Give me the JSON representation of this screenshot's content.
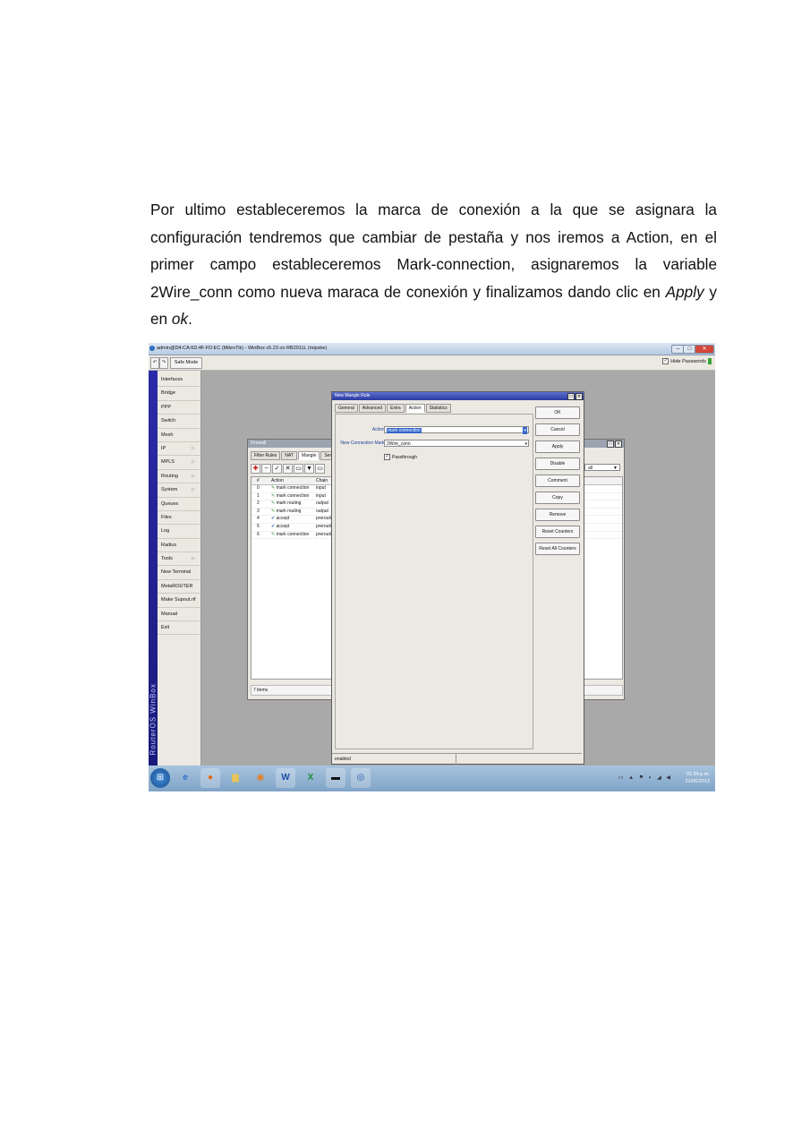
{
  "paragraph": {
    "part1": "Por ultimo estableceremos la marca de conexión a la que se asignara la configuración tendremos que cambiar de pestaña y nos iremos a Action, en el primer campo estableceremos Mark-connection, asignaremos la variable 2Wire_conn como nueva maraca de conexión y finalizamos dando clic en ",
    "apply": "Apply",
    "part2": " y en ",
    "ok": "ok",
    "part3": "."
  },
  "window": {
    "title": "admin@D4:CA:6D:4F:FD:EC (MikroTik) - WinBox v5.23 on RB2011L (mipsbe)",
    "safe_mode": "Safe Mode",
    "hide_passwords": "Hide Passwords"
  },
  "sidebar": {
    "brand": "RouterOS WinBox",
    "items": [
      {
        "label": "Interfaces"
      },
      {
        "label": "Bridge"
      },
      {
        "label": "PPP"
      },
      {
        "label": "Switch"
      },
      {
        "label": "Mesh"
      },
      {
        "label": "IP",
        "submenu": true
      },
      {
        "label": "MPLS",
        "submenu": true
      },
      {
        "label": "Routing",
        "submenu": true
      },
      {
        "label": "System",
        "submenu": true
      },
      {
        "label": "Queues"
      },
      {
        "label": "Files"
      },
      {
        "label": "Log"
      },
      {
        "label": "Radius"
      },
      {
        "label": "Tools",
        "submenu": true
      },
      {
        "label": "New Terminal"
      },
      {
        "label": "MetaROUTER"
      },
      {
        "label": "Make Supout.rif"
      },
      {
        "label": "Manual"
      },
      {
        "label": "Exit"
      }
    ]
  },
  "firewall": {
    "title": "Firewall",
    "tabs": [
      "Filter Rules",
      "NAT",
      "Mangle",
      "Service P"
    ],
    "filter_value": "all",
    "columns": [
      "#",
      "Action",
      "Chain"
    ],
    "rows": [
      {
        "num": "0",
        "action": "mark connection",
        "chain": "input",
        "icon": "pencil"
      },
      {
        "num": "1",
        "action": "mark connection",
        "chain": "input",
        "icon": "pencil"
      },
      {
        "num": "2",
        "action": "mark routing",
        "chain": "output",
        "icon": "pencil"
      },
      {
        "num": "3",
        "action": "mark routing",
        "chain": "output",
        "icon": "pencil"
      },
      {
        "num": "4",
        "action": "accept",
        "chain": "prerouti",
        "icon": "check"
      },
      {
        "num": "5",
        "action": "accept",
        "chain": "prerouti",
        "icon": "check"
      },
      {
        "num": "6",
        "action": "mark connection",
        "chain": "prerouti",
        "icon": "pencil"
      }
    ],
    "status": "7 items"
  },
  "mangle_rule": {
    "title": "New Mangle Rule",
    "tabs": [
      "General",
      "Advanced",
      "Extra",
      "Action",
      "Statistics"
    ],
    "active_tab": "Action",
    "action_label": "Action:",
    "action_value": "mark connection",
    "conn_mark_label": "New Connection Mark:",
    "conn_mark_value": "2Wire_conn",
    "passthrough_label": "Passthrough",
    "buttons": {
      "ok": "OK",
      "cancel": "Cancel",
      "apply": "Apply",
      "disable": "Disable",
      "comment": "Comment",
      "copy": "Copy",
      "remove": "Remove",
      "reset_counters": "Reset Counters",
      "reset_all_counters": "Reset All Counters"
    },
    "status": "enabled"
  },
  "taskbar": {
    "time": "01:34 p.m.",
    "date": "21/06/2013"
  }
}
